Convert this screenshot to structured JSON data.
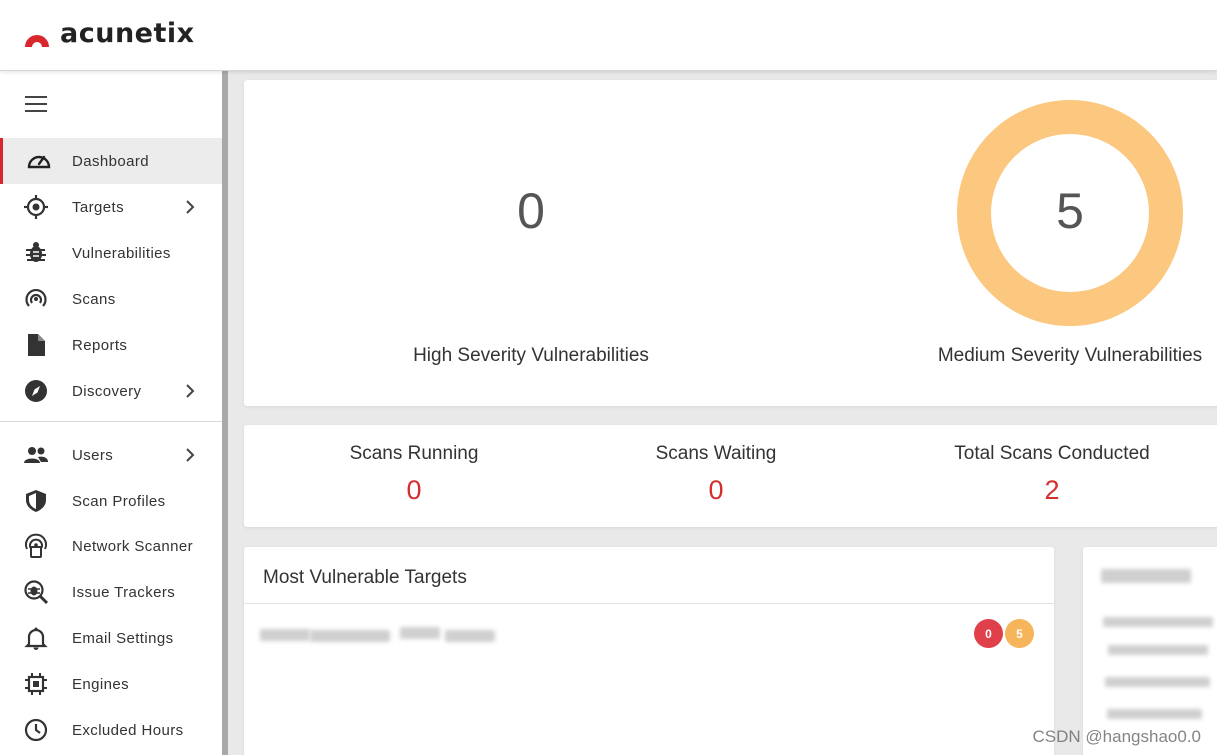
{
  "app": {
    "logo_text": "acunetix",
    "brand_color": "#d9272e"
  },
  "sidebar": {
    "menu_icon": "hamburger-icon",
    "items": [
      {
        "label": "Dashboard",
        "icon": "dashboard-gauge-icon",
        "active": true,
        "has_submenu": false
      },
      {
        "label": "Targets",
        "icon": "target-icon",
        "active": false,
        "has_submenu": true
      },
      {
        "label": "Vulnerabilities",
        "icon": "bug-icon",
        "active": false,
        "has_submenu": false
      },
      {
        "label": "Scans",
        "icon": "radar-icon",
        "active": false,
        "has_submenu": false
      },
      {
        "label": "Reports",
        "icon": "document-icon",
        "active": false,
        "has_submenu": false
      },
      {
        "label": "Discovery",
        "icon": "compass-icon",
        "active": false,
        "has_submenu": true
      },
      {
        "label": "Users",
        "icon": "users-icon",
        "active": false,
        "has_submenu": true
      },
      {
        "label": "Scan Profiles",
        "icon": "shield-icon",
        "active": false,
        "has_submenu": false
      },
      {
        "label": "Network Scanner",
        "icon": "network-scanner-icon",
        "active": false,
        "has_submenu": false
      },
      {
        "label": "Issue Trackers",
        "icon": "bug-search-icon",
        "active": false,
        "has_submenu": false
      },
      {
        "label": "Email Settings",
        "icon": "bell-icon",
        "active": false,
        "has_submenu": false
      },
      {
        "label": "Engines",
        "icon": "chip-icon",
        "active": false,
        "has_submenu": false
      },
      {
        "label": "Excluded Hours",
        "icon": "clock-icon",
        "active": false,
        "has_submenu": false
      }
    ]
  },
  "severity": {
    "high": {
      "value": "0",
      "label": "High Severity Vulnerabilities"
    },
    "medium": {
      "value": "5",
      "label": "Medium Severity Vulnerabilities",
      "ring_color": "#fcc77e"
    }
  },
  "scan_stats": [
    {
      "label": "Scans Running",
      "value": "0"
    },
    {
      "label": "Scans Waiting",
      "value": "0"
    },
    {
      "label": "Total Scans Conducted",
      "value": "2"
    }
  ],
  "most_vulnerable": {
    "title": "Most Vulnerable Targets",
    "rows": [
      {
        "target": "",
        "high": "0",
        "medium": "5"
      }
    ],
    "high_color": "#e0404a",
    "medium_color": "#f6b55a"
  },
  "watermark": "CSDN @hangshao0.0"
}
